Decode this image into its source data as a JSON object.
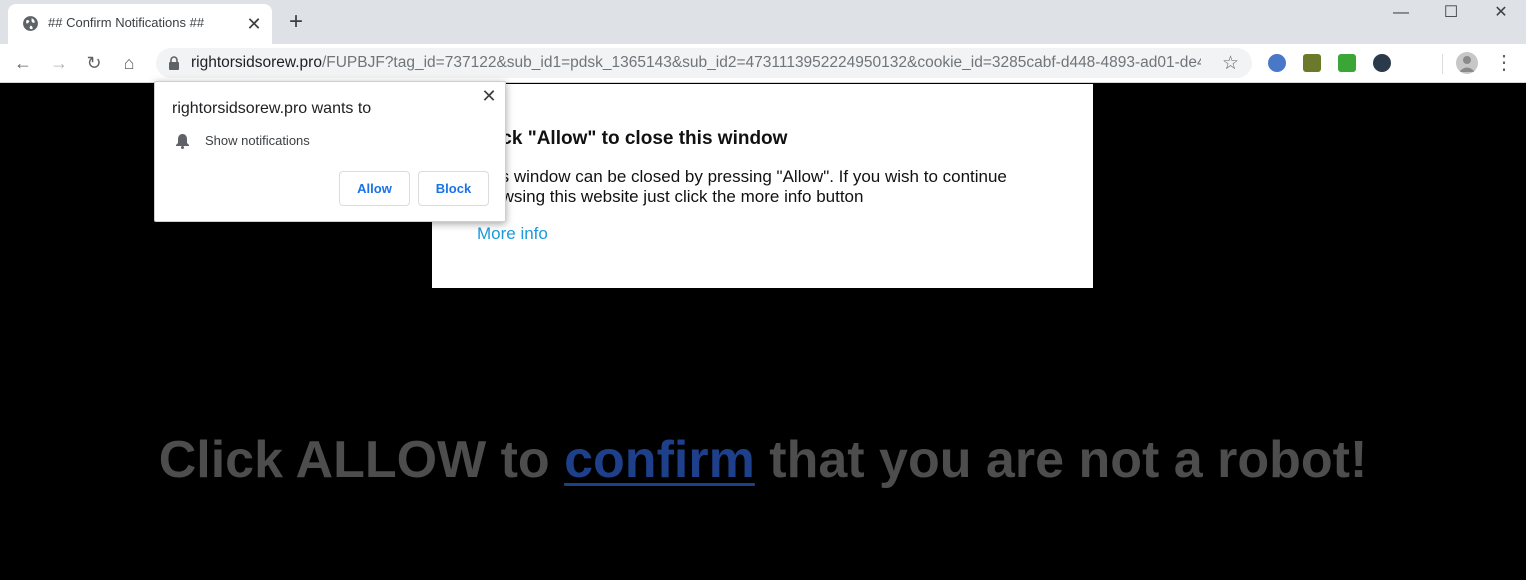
{
  "browser": {
    "tab": {
      "title": "## Confirm Notifications ##"
    },
    "new_tab_label": "+",
    "window_controls": {
      "minimize": "—",
      "maximize": "☐",
      "close": "✕"
    },
    "nav": {
      "back": "←",
      "forward": "→",
      "reload": "↻",
      "home": "⌂"
    },
    "url": {
      "domain": "rightorsidsorew.pro",
      "path": "/FUPBJF?tag_id=737122&sub_id1=pdsk_1365143&sub_id2=4731113952224950132&cookie_id=3285cabf-d448-4893-ad01-de4..."
    },
    "star": "☆",
    "menu": "⋮",
    "extensions": [
      {
        "name": "globe-extension-icon",
        "color": "#4a78c9"
      },
      {
        "name": "cc-extension-icon",
        "color": "#6b7a2a"
      },
      {
        "name": "green-extension-icon",
        "color": "#3aa635"
      },
      {
        "name": "a-extension-icon",
        "color": "#2b3a4a"
      }
    ]
  },
  "permission_popup": {
    "title": "rightorsidsorew.pro wants to",
    "permission": "Show notifications",
    "allow_label": "Allow",
    "block_label": "Block",
    "close": "✕"
  },
  "modal": {
    "title": "Click \"Allow\" to close this window",
    "body": "This window can be closed by pressing \"Allow\". If you wish to continue browsing this website just click the more info button",
    "link": "More info"
  },
  "headline": {
    "before": "Click ALLOW to ",
    "link": "confirm",
    "after": " that you are not a robot!"
  },
  "colors": {
    "link_blue": "#1a9ad9",
    "button_blue": "#1a73e8",
    "headline_gray": "#4d4d4d",
    "headline_link": "#1e3f8a"
  }
}
